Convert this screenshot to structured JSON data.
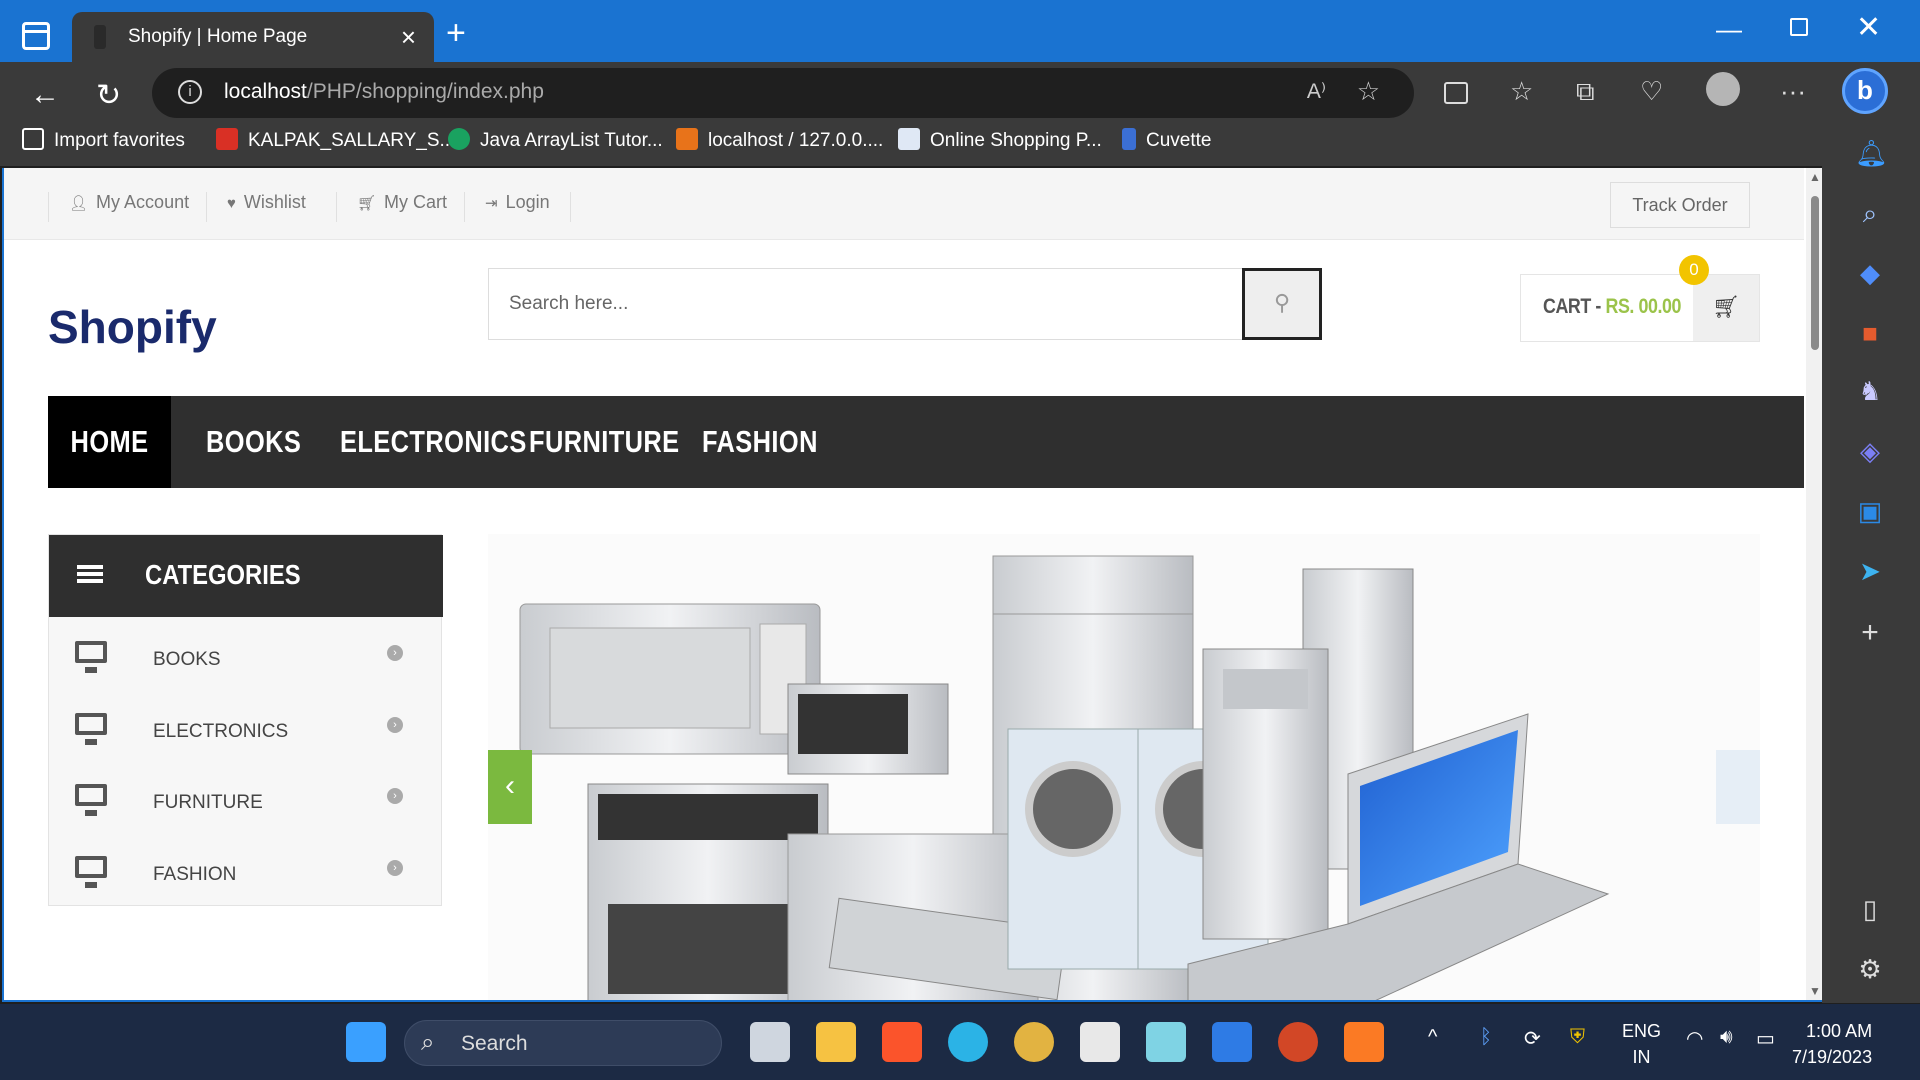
{
  "browser": {
    "tab_title": "Shopify | Home Page",
    "url_host": "localhost",
    "url_path": "/PHP/shopping/index.php",
    "bookmarks": [
      "Import favorites",
      "KALPAK_SALLARY_S...",
      "Java ArrayList Tutor...",
      "localhost / 127.0.0....",
      "Online Shopping P...",
      "Cuvette"
    ]
  },
  "topbar": {
    "links": [
      "My Account",
      "Wishlist",
      "My Cart",
      "Login"
    ],
    "track_order": "Track Order"
  },
  "header": {
    "logo": "Shopify",
    "search_placeholder": "Search here...",
    "cart_label": "CART -",
    "cart_amount": "RS. 00.00",
    "cart_count": "0"
  },
  "menu": [
    "HOME",
    "BOOKS",
    "ELECTRONICS",
    "FURNITURE",
    "FASHION"
  ],
  "categories": {
    "title": "CATEGORIES",
    "items": [
      "BOOKS",
      "ELECTRONICS",
      "FURNITURE",
      "FASHION"
    ]
  },
  "taskbar": {
    "search_label": "Search",
    "lang_1": "ENG",
    "lang_2": "IN",
    "time": "1:00 AM",
    "date": "7/19/2023"
  },
  "colors": {
    "titlebar": "#1a73d1",
    "nav_bg": "#2f2f2f",
    "accent_green": "#7bb93f",
    "logo_blue": "#1a2a6c",
    "badge_yellow": "#f2c400"
  }
}
